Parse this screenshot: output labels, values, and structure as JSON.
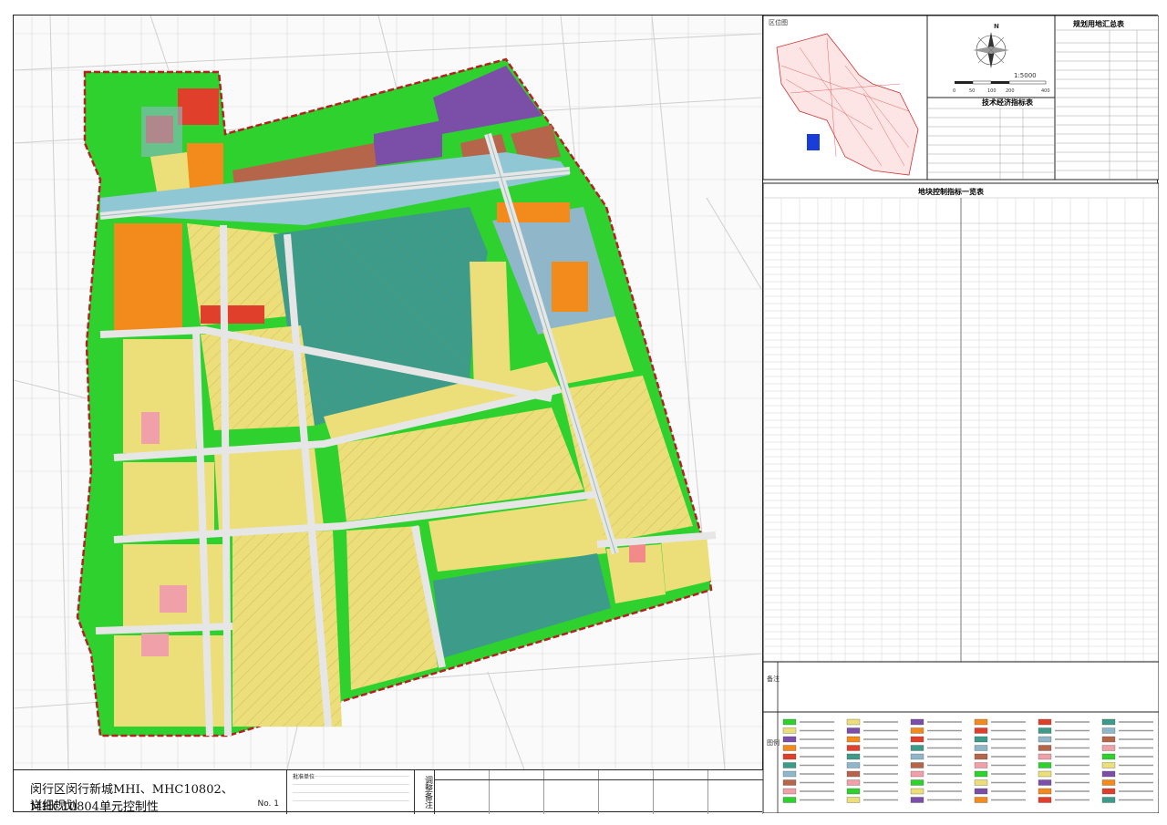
{
  "map": {
    "scale_text": "1:5000",
    "north_label": "N",
    "scale_ticks": [
      "0",
      "50",
      "100",
      "200",
      "400"
    ]
  },
  "panels": {
    "location_title": "区位图",
    "table1_title": "规划用地汇总表",
    "table2_title": "技术经济指标表",
    "table3_title": "地块控制指标一览表",
    "notes_label": "备注",
    "legend_label": "图例"
  },
  "title_block": {
    "project_title_line1": "闵行区闵行新城MHI、MHC10802、MHC10804单元控制性",
    "project_title_line2": "详细规划",
    "sheet_no": "No. 1",
    "approval_label": "批准单位",
    "side_label": "调整备注"
  },
  "colors": {
    "green": "#2ed12e",
    "residential": "#ecde79",
    "purple": "#7b4fa8",
    "orange": "#f28a1c",
    "red": "#e0402b",
    "teal": "#3d9b8a",
    "blue_grey": "#8fb7c9",
    "brown": "#b5654a",
    "pink": "#f0a0a8",
    "boundary": "#b22222"
  }
}
